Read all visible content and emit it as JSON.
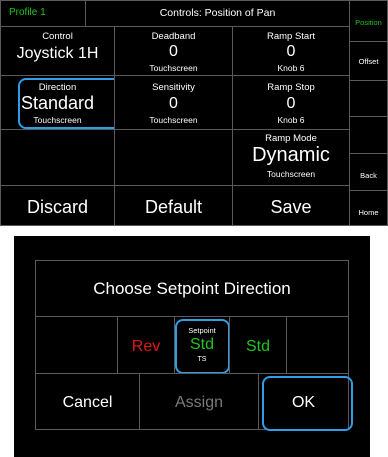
{
  "colors": {
    "accent": "#2f9ee6",
    "green": "#22c322",
    "red": "#e01818",
    "muted": "#7a7a7a"
  },
  "header": {
    "profile": "Profile 1",
    "title": "Controls: Position of Pan"
  },
  "grid": {
    "control": {
      "label": "Control",
      "value": "Joystick 1H"
    },
    "deadband": {
      "label": "Deadband",
      "value": "0",
      "sub": "Touchscreen"
    },
    "ramp_start": {
      "label": "Ramp Start",
      "value": "0",
      "sub": "Knob 6"
    },
    "direction": {
      "label": "Direction",
      "value": "Standard",
      "sub": "Touchscreen"
    },
    "sensitivity": {
      "label": "Sensitivity",
      "value": "0",
      "sub": "Touchscreen"
    },
    "ramp_stop": {
      "label": "Ramp Stop",
      "value": "0",
      "sub": "Knob 6"
    },
    "ramp_mode": {
      "label": "Ramp Mode",
      "value": "Dynamic",
      "sub": "Touchscreen"
    }
  },
  "actions": {
    "discard": "Discard",
    "default": "Default",
    "save": "Save"
  },
  "side": {
    "position": "Position",
    "offset": "Offset",
    "back": "Back",
    "home": "Home"
  },
  "dialog": {
    "title": "Choose Setpoint Direction",
    "rev": "Rev",
    "setpoint_label": "Setpoint",
    "setpoint_value": "Std",
    "setpoint_sub": "TS",
    "std": "Std",
    "cancel": "Cancel",
    "assign": "Assign",
    "ok": "OK"
  }
}
